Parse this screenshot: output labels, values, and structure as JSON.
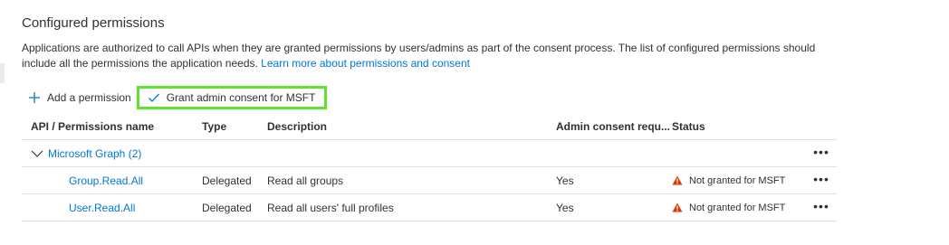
{
  "section": {
    "title": "Configured permissions",
    "description": "Applications are authorized to call APIs when they are granted permissions by users/admins as part of the consent process. The list of configured permissions should include all the permissions the application needs.",
    "learn_more_link": "Learn more about permissions and consent"
  },
  "toolbar": {
    "add_permission_label": "Add a permission",
    "grant_consent_label": "Grant admin consent for MSFT"
  },
  "table": {
    "columns": {
      "name": "API / Permissions name",
      "type": "Type",
      "description": "Description",
      "admin_consent": "Admin consent requ...",
      "status": "Status"
    },
    "group": {
      "label": "Microsoft Graph (2)",
      "more": "•••"
    },
    "rows": [
      {
        "name": "Group.Read.All",
        "type": "Delegated",
        "description": "Read all groups",
        "admin_consent": "Yes",
        "status": "Not granted for MSFT",
        "more": "•••"
      },
      {
        "name": "User.Read.All",
        "type": "Delegated",
        "description": "Read all users' full profiles",
        "admin_consent": "Yes",
        "status": "Not granted for MSFT",
        "more": "•••"
      }
    ]
  },
  "colors": {
    "link": "#0078d4",
    "highlight_border": "#5ce62a",
    "warning": "#d83b01",
    "text": "#323130"
  }
}
